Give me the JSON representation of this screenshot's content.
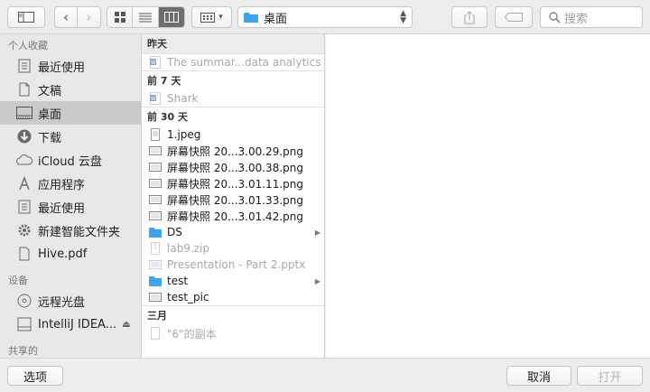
{
  "toolbar": {
    "path": {
      "label": "桌面",
      "icon": "folder-icon"
    },
    "search": {
      "placeholder": "搜索",
      "icon": "search-icon"
    }
  },
  "sidebar": {
    "sections": [
      {
        "title": "个人收藏",
        "items": [
          {
            "label": "最近使用",
            "icon": "recent-icon"
          },
          {
            "label": "文稿",
            "icon": "documents-icon"
          },
          {
            "label": "桌面",
            "icon": "desktop-icon",
            "selected": true
          },
          {
            "label": "下载",
            "icon": "download-icon"
          },
          {
            "label": "iCloud 云盘",
            "icon": "cloud-icon"
          },
          {
            "label": "应用程序",
            "icon": "applications-icon"
          },
          {
            "label": "最近使用",
            "icon": "recent-icon"
          },
          {
            "label": "新建智能文件夹",
            "icon": "gear-icon"
          },
          {
            "label": "Hive.pdf",
            "icon": "file-icon"
          }
        ]
      },
      {
        "title": "设备",
        "items": [
          {
            "label": "远程光盘",
            "icon": "disc-icon"
          },
          {
            "label": "IntelliJ IDEA...",
            "icon": "drive-icon",
            "eject": true
          }
        ]
      },
      {
        "title": "共享的",
        "items": []
      }
    ]
  },
  "file_list": {
    "groups": [
      {
        "title": "昨天",
        "items": [
          {
            "name": "The summar...data analytics",
            "icon": "word-doc-icon",
            "dim": true
          }
        ]
      },
      {
        "title": "前 7 天",
        "items": [
          {
            "name": "Shark",
            "icon": "word-doc-icon",
            "dim": true
          }
        ]
      },
      {
        "title": "前 30 天",
        "items": [
          {
            "name": "1.jpeg",
            "icon": "image-file-icon"
          },
          {
            "name": "屏幕快照 20...3.00.29.png",
            "icon": "screenshot-icon"
          },
          {
            "name": "屏幕快照 20...3.00.38.png",
            "icon": "screenshot-icon"
          },
          {
            "name": "屏幕快照 20...3.01.11.png",
            "icon": "screenshot-icon"
          },
          {
            "name": "屏幕快照 20...3.01.33.png",
            "icon": "screenshot-icon"
          },
          {
            "name": "屏幕快照 20...3.01.42.png",
            "icon": "screenshot-icon"
          },
          {
            "name": "DS",
            "icon": "folder-icon",
            "folder": true
          },
          {
            "name": "lab9.zip",
            "icon": "zip-icon",
            "dim": true
          },
          {
            "name": "Presentation - Part 2.pptx",
            "icon": "pptx-icon",
            "dim": true
          },
          {
            "name": "test",
            "icon": "folder-icon",
            "folder": true
          },
          {
            "name": "test_pic",
            "icon": "screenshot-icon"
          }
        ]
      },
      {
        "title": "三月",
        "items": [
          {
            "name": "\"6\"的副本",
            "icon": "file-icon",
            "dim": true
          }
        ]
      }
    ]
  },
  "buttons": {
    "options": "选项",
    "cancel": "取消",
    "open": "打开"
  }
}
